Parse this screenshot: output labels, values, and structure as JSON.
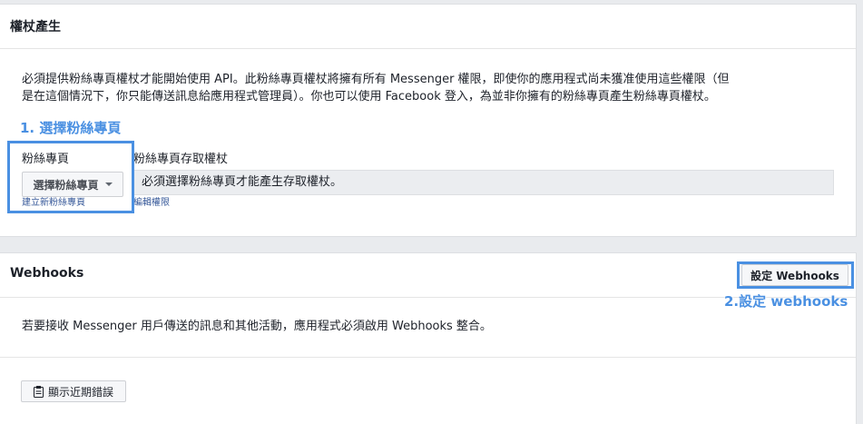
{
  "token_section": {
    "title": "權杖產生",
    "description_line1": "必須提供粉絲專頁權杖才能開始使用 API。此粉絲專頁權杖將擁有所有 Messenger 權限，即使你的應用程式尚未獲准使用這些權限（但",
    "description_line2": "是在這個情況下，你只能傳送訊息給應用程式管理員）。你也可以使用 Facebook 登入，為並非你擁有的粉絲專頁產生粉絲專頁權杖。",
    "page_label": "粉絲專頁",
    "page_select_value": "選擇粉絲專頁",
    "create_page_link": "建立新粉絲專頁",
    "token_label": "粉絲專頁存取權杖",
    "token_placeholder": "必須選擇粉絲專頁才能產生存取權杖。",
    "edit_permissions_link": "編輯權限"
  },
  "webhooks_section": {
    "title": "Webhooks",
    "setup_button": "設定 Webhooks",
    "description": "若要接收 Messenger 用戶傳送的訊息和其他活動，應用程式必須啟用 Webhooks 整合。",
    "show_errors_button": "顯示近期錯誤"
  },
  "annotations": {
    "step1": "1. 選擇粉絲專頁",
    "step2": "2.設定 webhooks"
  },
  "colors": {
    "annotation": "#4a90e2",
    "link": "#365899",
    "background": "#e9ebee"
  }
}
